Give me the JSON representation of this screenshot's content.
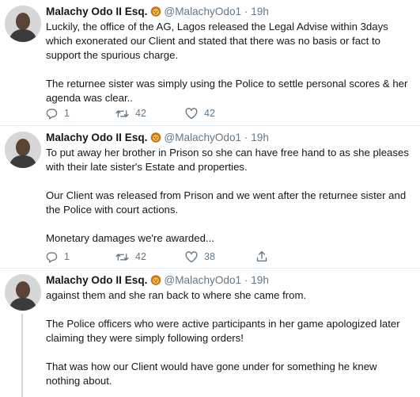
{
  "tweets": [
    {
      "author": "Malachy Odo II Esq.",
      "badge_icon": "lion-face-emoji-icon",
      "handle": "@MalachyOdo1",
      "separator": "·",
      "time": "19h",
      "paragraphs": [
        "Luckily, the office of the AG, Lagos released the Legal Advise within 3days which exonerated our Client and stated that there was no basis or fact to support the spurious charge.",
        "The returnee sister was simply using the Police to settle personal scores & her agenda was clear.."
      ],
      "replies": "1",
      "retweets": "42",
      "likes": "42"
    },
    {
      "author": "Malachy Odo II Esq.",
      "badge_icon": "lion-face-emoji-icon",
      "handle": "@MalachyOdo1",
      "separator": "·",
      "time": "19h",
      "paragraphs": [
        "To put away her brother in Prison so she can have free hand to as she pleases with their late sister's Estate and properties.",
        "Our Client was released from Prison and we went after the returnee sister and the Police with court actions.",
        "Monetary damages we're awarded..."
      ],
      "replies": "1",
      "retweets": "42",
      "likes": "38"
    },
    {
      "author": "Malachy Odo II Esq.",
      "badge_icon": "lion-face-emoji-icon",
      "handle": "@MalachyOdo1",
      "separator": "·",
      "time": "19h",
      "paragraphs": [
        "against them and she ran back to where she came from.",
        "The Police officers who were active participants in her game apologized later claiming they were simply following orders!",
        "That was how our Client would have gone under for something he knew nothing about."
      ]
    }
  ]
}
